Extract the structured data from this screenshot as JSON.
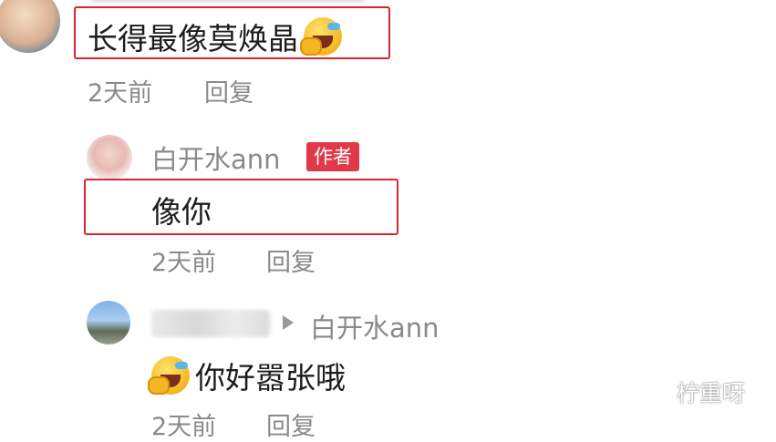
{
  "comments": [
    {
      "content_text": "长得最像莫焕晶",
      "emoji": "laughing-crying-emoji",
      "time": "2天前",
      "reply_label": "回复"
    },
    {
      "username": "白开水ann",
      "badge": "作者",
      "content_text": "像你",
      "time": "2天前",
      "reply_label": "回复"
    },
    {
      "username_hidden": true,
      "reply_to": "白开水ann",
      "emoji": "laughing-crying-emoji",
      "content_text": "你好嚣张哦",
      "time": "2天前",
      "reply_label": "回复"
    }
  ],
  "watermark": "柠重呀",
  "colors": {
    "highlight_box": "#d9252e",
    "author_badge": "#e0394a",
    "meta_text": "#8a8a8a"
  }
}
